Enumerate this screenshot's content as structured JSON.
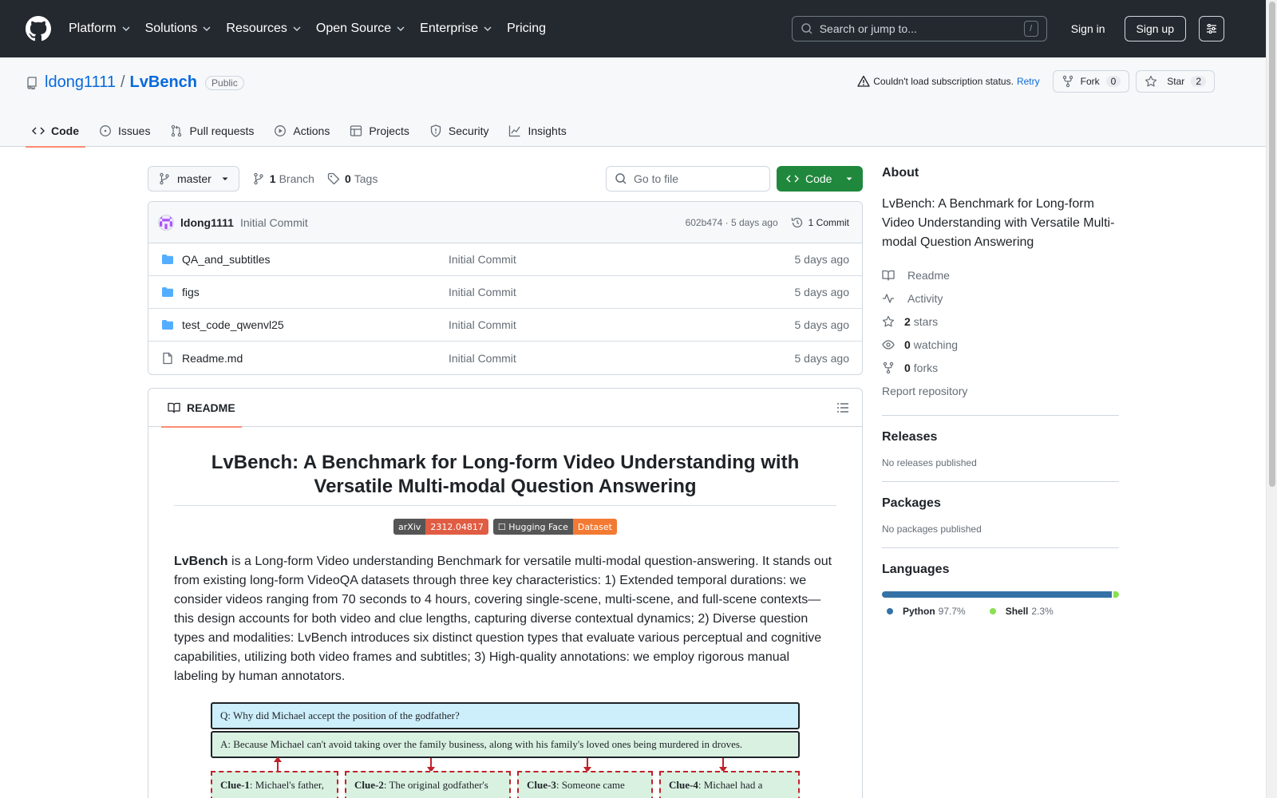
{
  "header": {
    "nav": [
      {
        "label": "Platform",
        "has_menu": true
      },
      {
        "label": "Solutions",
        "has_menu": true
      },
      {
        "label": "Resources",
        "has_menu": true
      },
      {
        "label": "Open Source",
        "has_menu": true
      },
      {
        "label": "Enterprise",
        "has_menu": true
      },
      {
        "label": "Pricing",
        "has_menu": false
      }
    ],
    "search_placeholder": "Search or jump to...",
    "search_shortcut": "/",
    "sign_in": "Sign in",
    "sign_up": "Sign up"
  },
  "repo": {
    "owner": "ldong1111",
    "separator": "/",
    "name": "LvBench",
    "visibility": "Public",
    "subscription_status": "Couldn't load subscription status.",
    "retry": "Retry",
    "fork_label": "Fork",
    "fork_count": "0",
    "star_label": "Star",
    "star_count": "2",
    "tabs": [
      {
        "label": "Code",
        "icon": "code-icon",
        "active": true
      },
      {
        "label": "Issues",
        "icon": "issue-icon",
        "active": false
      },
      {
        "label": "Pull requests",
        "icon": "pull-request-icon",
        "active": false
      },
      {
        "label": "Actions",
        "icon": "play-icon",
        "active": false
      },
      {
        "label": "Projects",
        "icon": "table-icon",
        "active": false
      },
      {
        "label": "Security",
        "icon": "shield-icon",
        "active": false
      },
      {
        "label": "Insights",
        "icon": "graph-icon",
        "active": false
      }
    ]
  },
  "file_nav": {
    "branch": "master",
    "branch_count": "1",
    "branch_label": "Branch",
    "tag_count": "0",
    "tag_label": "Tags",
    "goto_placeholder": "Go to file",
    "code_button": "Code"
  },
  "latest_commit": {
    "author": "ldong1111",
    "message": "Initial Commit",
    "meta": "602b474 · 5 days ago",
    "commit_count": "1 Commit"
  },
  "files": [
    {
      "name": "QA_and_subtitles",
      "type": "folder",
      "message": "Initial Commit",
      "date": "5 days ago"
    },
    {
      "name": "figs",
      "type": "folder",
      "message": "Initial Commit",
      "date": "5 days ago"
    },
    {
      "name": "test_code_qwenvl25",
      "type": "folder",
      "message": "Initial Commit",
      "date": "5 days ago"
    },
    {
      "name": "Readme.md",
      "type": "file",
      "message": "Initial Commit",
      "date": "5 days ago"
    }
  ],
  "readme": {
    "tab_label": "README",
    "title": "LvBench: A Benchmark for Long-form Video Understanding with Versatile Multi-modal Question Answering",
    "badges": [
      {
        "left": "arXiv",
        "right": "2312.04817",
        "right_color": "#e05d44"
      },
      {
        "left": "☐ Hugging Face",
        "right": "Dataset",
        "right_color": "#f37a33"
      }
    ],
    "intro_bold": "LvBench",
    "intro_text": " is a Long-form Video understanding Benchmark for versatile multi-modal question-answering. It stands out from existing long-form VideoQA datasets through three key characteristics: 1) Extended temporal durations: we consider videos ranging from 70 seconds to 4 hours, covering single-scene, multi-scene, and full-scene contexts—this design accounts for both video and clue lengths, capturing diverse contextual dynamics; 2) Diverse question types and modalities: LvBench introduces six distinct question types that evaluate various perceptual and cognitive capabilities, utilizing both video frames and subtitles; 3) High-quality annotations: we employ rigorous manual labeling by human annotators.",
    "figure": {
      "question": "Q: Why did Michael accept the position of the godfather?",
      "answer": "A: Because Michael can't avoid taking over the family business, along with his family's loved ones being murdered in droves.",
      "clues": [
        {
          "label": "Clue-1",
          "text": ": Michael's father,"
        },
        {
          "label": "Clue-2",
          "text": ": The original godfather's"
        },
        {
          "label": "Clue-3",
          "text": ": Someone came"
        },
        {
          "label": "Clue-4",
          "text": ": Michael had a"
        }
      ]
    }
  },
  "sidebar": {
    "about_title": "About",
    "description": "LvBench: A Benchmark for Long-form Video Understanding with Versatile Multi-modal Question Answering",
    "links": [
      {
        "icon": "book-icon",
        "count": "",
        "label": "Readme"
      },
      {
        "icon": "pulse-icon",
        "count": "",
        "label": "Activity"
      },
      {
        "icon": "star-icon",
        "count": "2",
        "label": "stars"
      },
      {
        "icon": "eye-icon",
        "count": "0",
        "label": "watching"
      },
      {
        "icon": "fork-icon",
        "count": "0",
        "label": "forks"
      }
    ],
    "report": "Report repository",
    "releases_title": "Releases",
    "releases_empty": "No releases published",
    "packages_title": "Packages",
    "packages_empty": "No packages published",
    "languages_title": "Languages",
    "languages": [
      {
        "name": "Python",
        "percent": "97.7%",
        "value": 97.7,
        "color": "#3572A5"
      },
      {
        "name": "Shell",
        "percent": "2.3%",
        "value": 2.3,
        "color": "#89e051"
      }
    ]
  }
}
